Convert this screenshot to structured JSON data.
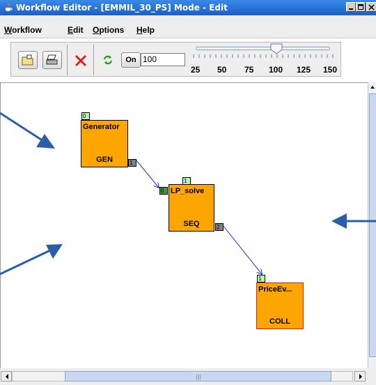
{
  "window": {
    "title": "Workflow Editor - [EMMIL_30_PS] Mode - Edit",
    "icon": "java-cup-icon"
  },
  "menu": [
    "Workflow",
    "Edit",
    "Options",
    "Help"
  ],
  "toolbar": {
    "buttons": [
      "open-folder-icon",
      "print-icon",
      "delete-x-icon",
      "refresh-icon"
    ],
    "on_label": "On",
    "zoom_value": "100",
    "zoom_slider": {
      "min": 25,
      "max": 150,
      "value": 100,
      "labels": [
        "25",
        "50",
        "75",
        "100",
        "125",
        "150"
      ]
    }
  },
  "workflow": {
    "nodes": [
      {
        "id": "generator",
        "title": "Generator",
        "type": "GEN",
        "in_port": "0",
        "out_port": "1"
      },
      {
        "id": "lp_solve",
        "title": "LP_solve",
        "type": "SEQ",
        "top_port": "1",
        "in_port": "0",
        "out_port": "2"
      },
      {
        "id": "priceev",
        "title": "PriceEv...",
        "type": "COLL",
        "in_port": "1"
      }
    ]
  },
  "colors": {
    "titlebar": "#1a5fc8",
    "node_fill": "#ffa500",
    "connector": "#1a2bd6",
    "annotation_arrow": "#2a5ea8"
  },
  "scroll": {
    "horizontal_grip": "|||"
  }
}
